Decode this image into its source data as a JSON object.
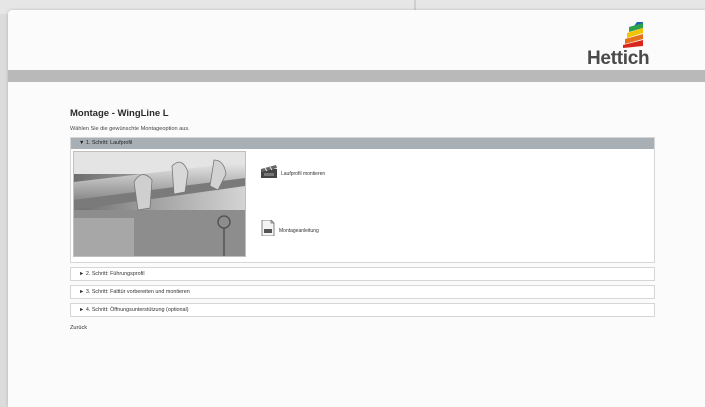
{
  "brand": {
    "name": "Hettich"
  },
  "page": {
    "title": "Montage - WingLine L",
    "instruction": "Wählen Sie die gewünschte Montageoption aus."
  },
  "steps": [
    {
      "label": "▼ 1. Schritt: Laufprofil",
      "expanded": true,
      "options": [
        {
          "label": "Laufprofil montieren",
          "icon": "film-clapper-icon"
        },
        {
          "label": "Montageanleitung",
          "icon": "pdf-document-icon"
        }
      ]
    },
    {
      "label": "► 2. Schritt: Führungsprofil",
      "expanded": false
    },
    {
      "label": "► 3. Schritt: Falttür vorbereiten und montieren",
      "expanded": false
    },
    {
      "label": "► 4. Schritt: Öffnungsunterstützung (optional)",
      "expanded": false
    }
  ],
  "back": {
    "label": "Zurück"
  },
  "colors": {
    "brand_bar": "#b9b9b9",
    "active_step_header": "#a9b0b5",
    "logo_stripes": [
      "#1f5fb4",
      "#2aa14a",
      "#f2c300",
      "#e5711d",
      "#d9261c"
    ]
  }
}
